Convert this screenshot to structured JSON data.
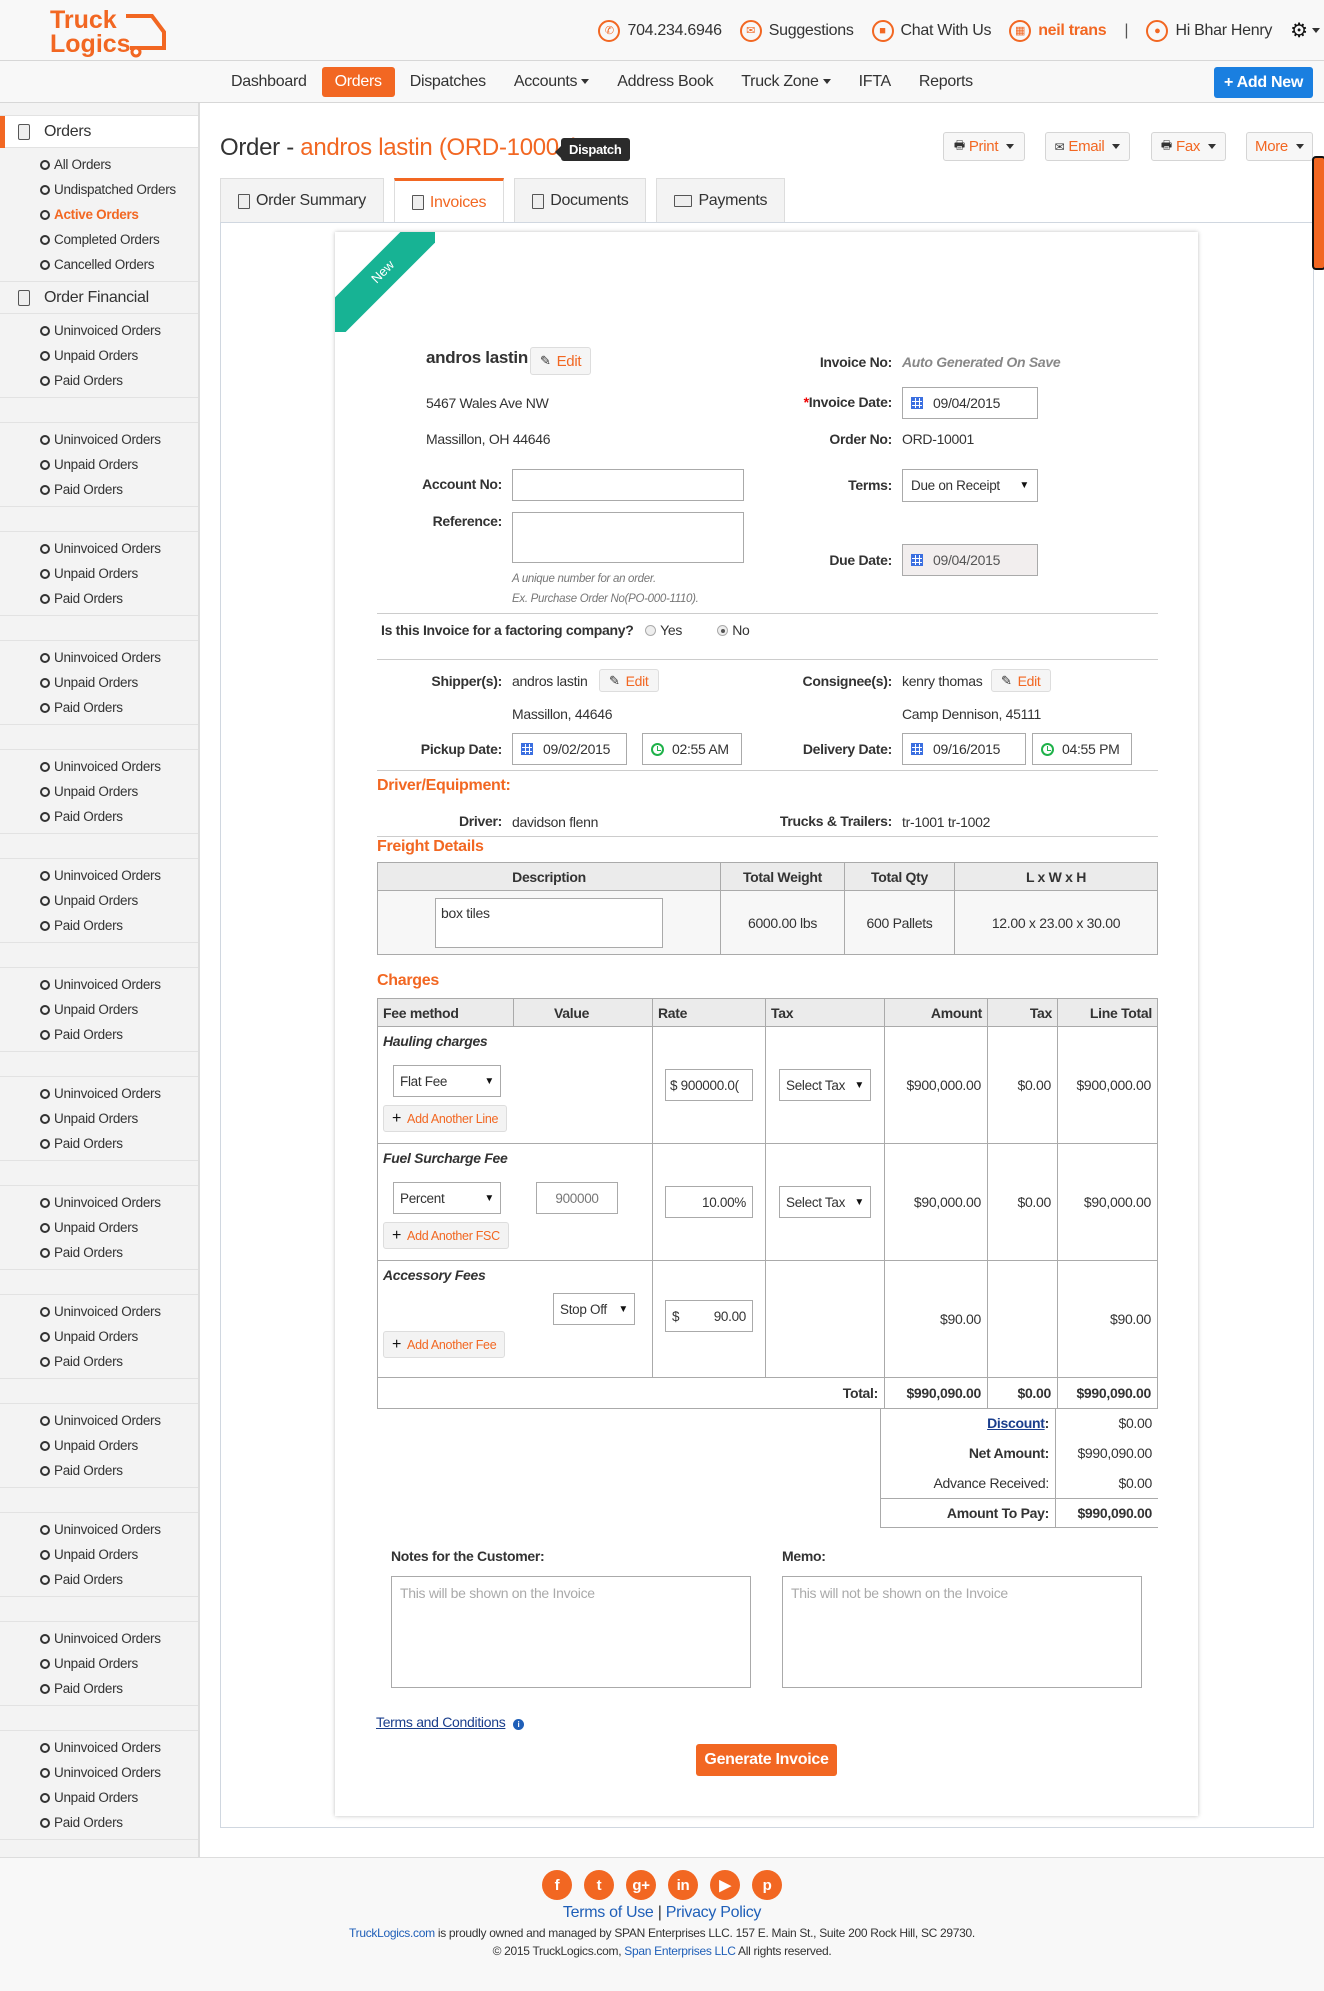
{
  "header": {
    "logo_text": [
      "Truck",
      "Logics"
    ],
    "phone": "704.234.6946",
    "suggestions": "Suggestions",
    "chat": "Chat With Us",
    "company": "neil trans",
    "separator": "|",
    "greeting": "Hi Bhar Henry"
  },
  "nav": {
    "items": [
      "Dashboard",
      "Orders",
      "Dispatches",
      "Accounts",
      "Address Book",
      "Truck Zone",
      "IFTA",
      "Reports"
    ],
    "active": "Orders",
    "add_new": "+ Add New"
  },
  "sidebar": {
    "orders_header": "Orders",
    "orders_items": [
      "All Orders",
      "Undispatched Orders",
      "Active Orders",
      "Completed Orders",
      "Cancelled Orders"
    ],
    "active_item": "Active Orders",
    "financial_header": "Order Financial",
    "financial_items": [
      "Uninvoiced Orders",
      "Unpaid Orders",
      "Paid Orders"
    ],
    "repeat_items": [
      "Uninvoiced Orders",
      "Unpaid Orders",
      "Paid Orders"
    ],
    "last_group_items": [
      "Uninvoiced Orders",
      "Uninvoiced Orders",
      "Unpaid Orders",
      "Paid Orders"
    ]
  },
  "page": {
    "title_prefix": "Order - ",
    "title_name": "andros lastin (ORD-10001)",
    "status_badge": "Dispatch",
    "actions": {
      "print": "Print",
      "email": "Email",
      "fax": "Fax",
      "more": "More"
    },
    "tabs": [
      "Order Summary",
      "Invoices",
      "Documents",
      "Payments"
    ],
    "active_tab": "Invoices"
  },
  "invoice": {
    "ribbon": "New",
    "customer_name": "andros lastin",
    "edit_label": "Edit",
    "address_line1": "5467 Wales Ave NW",
    "address_line2": "Massillon, OH 44646",
    "account_no_label": "Account No:",
    "account_no_value": "",
    "reference_label": "Reference:",
    "reference_value": "",
    "reference_hint1": "A unique number for an order.",
    "reference_hint2": "Ex. Purchase Order No(PO-000-1110).",
    "invoice_no_label": "Invoice No:",
    "invoice_no_value": "Auto Generated On Save",
    "invoice_date_required": "*",
    "invoice_date_label": "Invoice Date:",
    "invoice_date": "09/04/2015",
    "order_no_label": "Order No:",
    "order_no": "ORD-10001",
    "terms_label": "Terms:",
    "terms_value": "Due on Receipt",
    "due_date_label": "Due Date:",
    "due_date": "09/04/2015",
    "factoring_question": "Is this Invoice for a factoring company?",
    "factoring_yes": "Yes",
    "factoring_no": "No",
    "factoring_selected": "No",
    "shipper_label": "Shipper(s):",
    "shipper_name": "andros lastin",
    "shipper_location": "Massillon, 44646",
    "consignee_label": "Consignee(s):",
    "consignee_name": "kenry thomas",
    "consignee_location": "Camp Dennison, 45111",
    "pickup_label": "Pickup Date:",
    "pickup_date": "09/02/2015",
    "pickup_time": "02:55 AM",
    "delivery_label": "Delivery Date:",
    "delivery_date": "09/16/2015",
    "delivery_time": "04:55 PM",
    "driver_section": "Driver/Equipment:",
    "driver_label": "Driver:",
    "driver_value": "davidson flenn",
    "trucks_label": "Trucks & Trailers:",
    "trucks_value": "tr-1001 tr-1002"
  },
  "freight": {
    "title": "Freight Details",
    "headers": [
      "Description",
      "Total Weight",
      "Total Qty",
      "L x W x H"
    ],
    "row": {
      "description": "box  tiles",
      "weight": "6000.00 lbs",
      "qty": "600 Pallets",
      "dims": "12.00 x 23.00 x 30.00"
    }
  },
  "charges": {
    "title": "Charges",
    "headers": [
      "Fee method",
      "Value",
      "Rate",
      "Tax",
      "Amount",
      "Tax",
      "Line Total"
    ],
    "hauling": {
      "title": "Hauling charges",
      "method": "Flat Fee",
      "rate": "$ 900000.0(",
      "tax_select": "Select Tax",
      "amount": "$900,000.00",
      "tax": "$0.00",
      "line_total": "$900,000.00",
      "add_label": "Add Another Line"
    },
    "fuel": {
      "title": "Fuel Surcharge Fee",
      "method": "Percent",
      "value": "900000",
      "rate": "10.00%",
      "tax_select": "Select Tax",
      "amount": "$90,000.00",
      "tax": "$0.00",
      "line_total": "$90,000.00",
      "add_label": "Add Another FSC"
    },
    "accessory": {
      "title": "Accessory Fees",
      "method": "Stop Off",
      "rate_symbol": "$",
      "rate": "90.00",
      "amount": "$90.00",
      "line_total": "$90.00",
      "add_label": "Add Another Fee"
    },
    "total_label": "Total:",
    "total_amount": "$990,090.00",
    "total_tax": "$0.00",
    "total_line": "$990,090.00",
    "discount_label": "Discount",
    "discount_value": "$0.00",
    "net_label": "Net Amount:",
    "net_value": "$990,090.00",
    "advance_label": "Advance Received:",
    "advance_value": "$0.00",
    "pay_label": "Amount To Pay:",
    "pay_value": "$990,090.00"
  },
  "notes": {
    "customer_label": "Notes for the Customer:",
    "customer_placeholder": "This will be shown on the Invoice",
    "memo_label": "Memo:",
    "memo_placeholder": "This will not be shown on the Invoice",
    "terms_link": "Terms and Conditions",
    "generate": "Generate Invoice"
  },
  "footer": {
    "social": [
      "facebook",
      "twitter",
      "google-plus",
      "linkedin",
      "youtube",
      "pinterest"
    ],
    "terms": "Terms of Use",
    "sep": "|",
    "privacy": "Privacy Policy",
    "owner_link": "TruckLogics.com",
    "owner_text": " is proudly owned and managed by SPAN Enterprises LLC. 157 E. Main St., Suite 200 Rock Hill, SC 29730.",
    "copyright": "© 2015 TruckLogics.com, ",
    "span_link": "Span Enterprises LLC",
    "rights": " All rights reserved."
  },
  "colors": {
    "brand": "#f26722",
    "accent_blue": "#1a7fe0",
    "ribbon": "#17b394"
  }
}
